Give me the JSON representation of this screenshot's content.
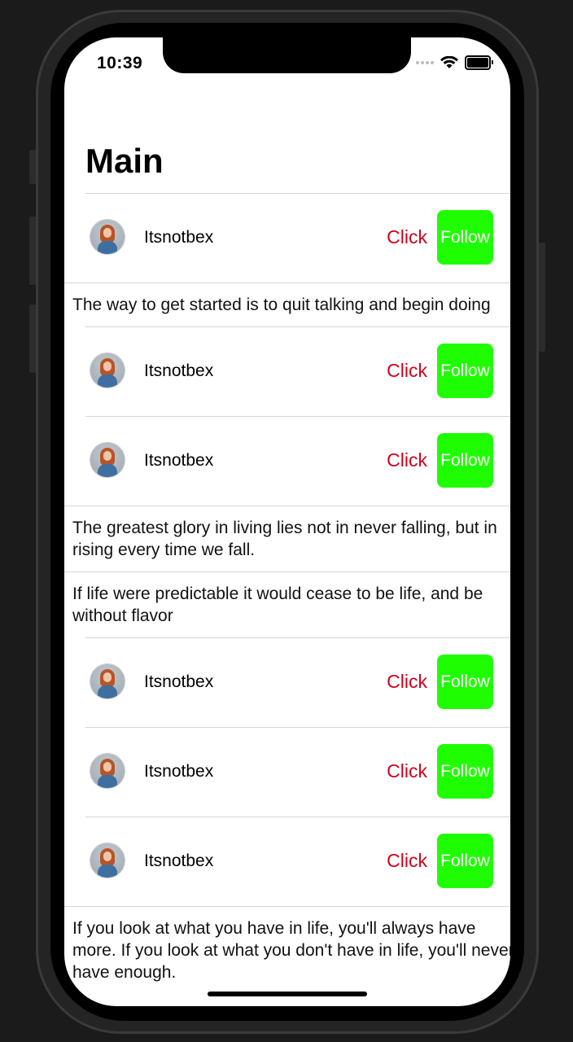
{
  "status_bar": {
    "time": "10:39"
  },
  "nav": {
    "title": "Main"
  },
  "colors": {
    "click_text": "#d0021b",
    "follow_bg": "#1ffe00",
    "follow_text": "#ffffff"
  },
  "rows": [
    {
      "type": "user",
      "username": "Itsnotbex",
      "click_label": "Click",
      "follow_label": "Follow"
    },
    {
      "type": "quote",
      "text": "The way to get started is to quit talking and begin doing"
    },
    {
      "type": "user",
      "username": "Itsnotbex",
      "click_label": "Click",
      "follow_label": "Follow"
    },
    {
      "type": "user",
      "username": "Itsnotbex",
      "click_label": "Click",
      "follow_label": "Follow"
    },
    {
      "type": "quote",
      "text": "The greatest glory in living lies not in never falling, but in rising every time we fall."
    },
    {
      "type": "quote",
      "text": "If life were predictable it would cease to be life, and be without flavor"
    },
    {
      "type": "user",
      "username": "Itsnotbex",
      "click_label": "Click",
      "follow_label": "Follow"
    },
    {
      "type": "user",
      "username": "Itsnotbex",
      "click_label": "Click",
      "follow_label": "Follow"
    },
    {
      "type": "user",
      "username": "Itsnotbex",
      "click_label": "Click",
      "follow_label": "Follow"
    },
    {
      "type": "quote",
      "text": "If you look at what you have in life, you'll always have more. If you look at what you don't have in life, you'll never have enough."
    }
  ]
}
